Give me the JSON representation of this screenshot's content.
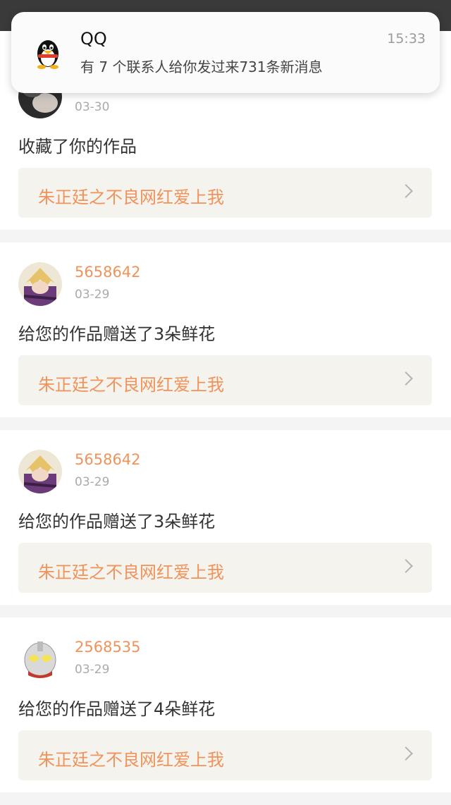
{
  "notification": {
    "app": "QQ",
    "time": "15:33",
    "message": "有 7 个联系人给你发过来731条新消息"
  },
  "feed": [
    {
      "user": "",
      "date": "03-30",
      "action": "收藏了你的作品",
      "work": "朱正廷之不良网红爱上我",
      "avatar": "dark-avatar"
    },
    {
      "user": "5658642",
      "date": "03-29",
      "action": "给您的作品赠送了3朵鲜花",
      "work": "朱正廷之不良网红爱上我",
      "avatar": "anime-avatar"
    },
    {
      "user": "5658642",
      "date": "03-29",
      "action": "给您的作品赠送了3朵鲜花",
      "work": "朱正廷之不良网红爱上我",
      "avatar": "anime-avatar"
    },
    {
      "user": "2568535",
      "date": "03-29",
      "action": "给您的作品赠送了4朵鲜花",
      "work": "朱正廷之不良网红爱上我",
      "avatar": "ultraman-avatar"
    }
  ]
}
